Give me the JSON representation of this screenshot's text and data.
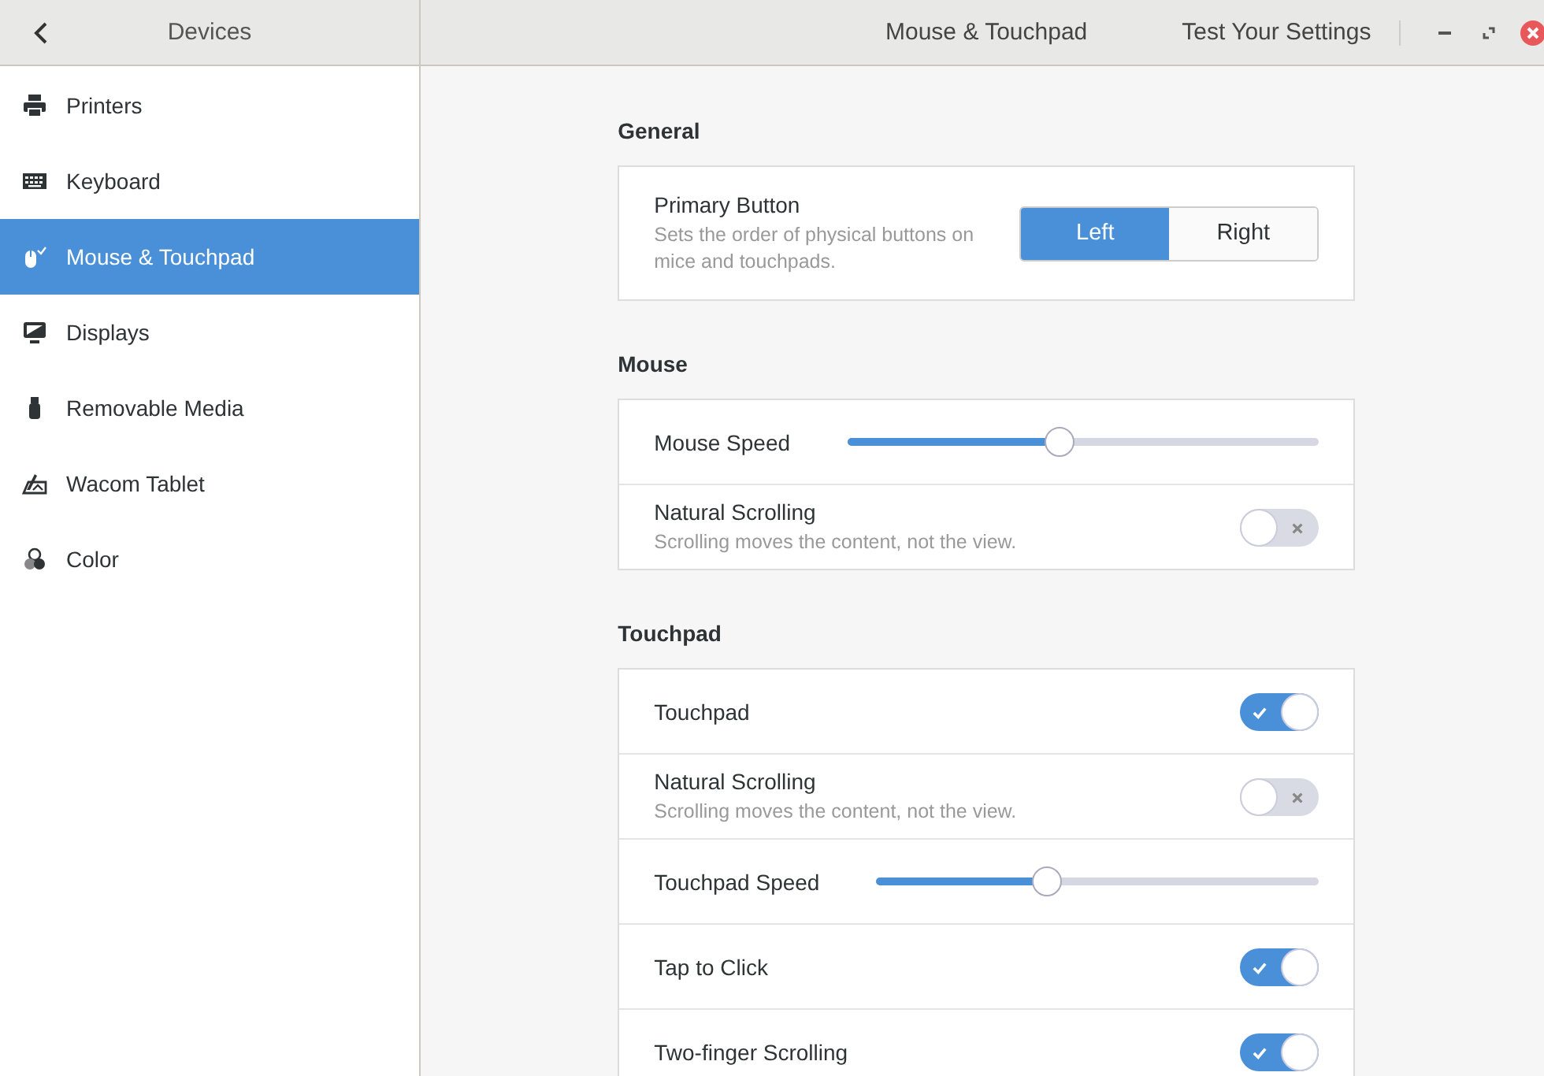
{
  "header": {
    "sidebar_title": "Devices",
    "window_title": "Mouse & Touchpad",
    "test_button": "Test Your Settings"
  },
  "sidebar": {
    "items": [
      {
        "label": "Printers",
        "selected": false
      },
      {
        "label": "Keyboard",
        "selected": false
      },
      {
        "label": "Mouse & Touchpad",
        "selected": true
      },
      {
        "label": "Displays",
        "selected": false
      },
      {
        "label": "Removable Media",
        "selected": false
      },
      {
        "label": "Wacom Tablet",
        "selected": false
      },
      {
        "label": "Color",
        "selected": false
      }
    ]
  },
  "sections": [
    {
      "title": "General",
      "rows": [
        {
          "kind": "segmented",
          "label": "Primary Button",
          "description": "Sets the order of physical buttons on mice and touchpads.",
          "options": [
            {
              "label": "Left",
              "selected": true
            },
            {
              "label": "Right",
              "selected": false
            }
          ]
        }
      ]
    },
    {
      "title": "Mouse",
      "rows": [
        {
          "kind": "slider",
          "label": "Mouse Speed",
          "level": 0.45
        },
        {
          "kind": "switch",
          "label": "Natural Scrolling",
          "description": "Scrolling moves the content, not the view.",
          "on": false
        }
      ]
    },
    {
      "title": "Touchpad",
      "rows": [
        {
          "kind": "switch",
          "label": "Touchpad",
          "on": true
        },
        {
          "kind": "switch",
          "label": "Natural Scrolling",
          "description": "Scrolling moves the content, not the view.",
          "on": false
        },
        {
          "kind": "slider",
          "label": "Touchpad Speed",
          "level": 0.385
        },
        {
          "kind": "switch",
          "label": "Tap to Click",
          "on": true
        },
        {
          "kind": "switch",
          "label": "Two-finger Scrolling",
          "on": true
        }
      ]
    }
  ]
}
